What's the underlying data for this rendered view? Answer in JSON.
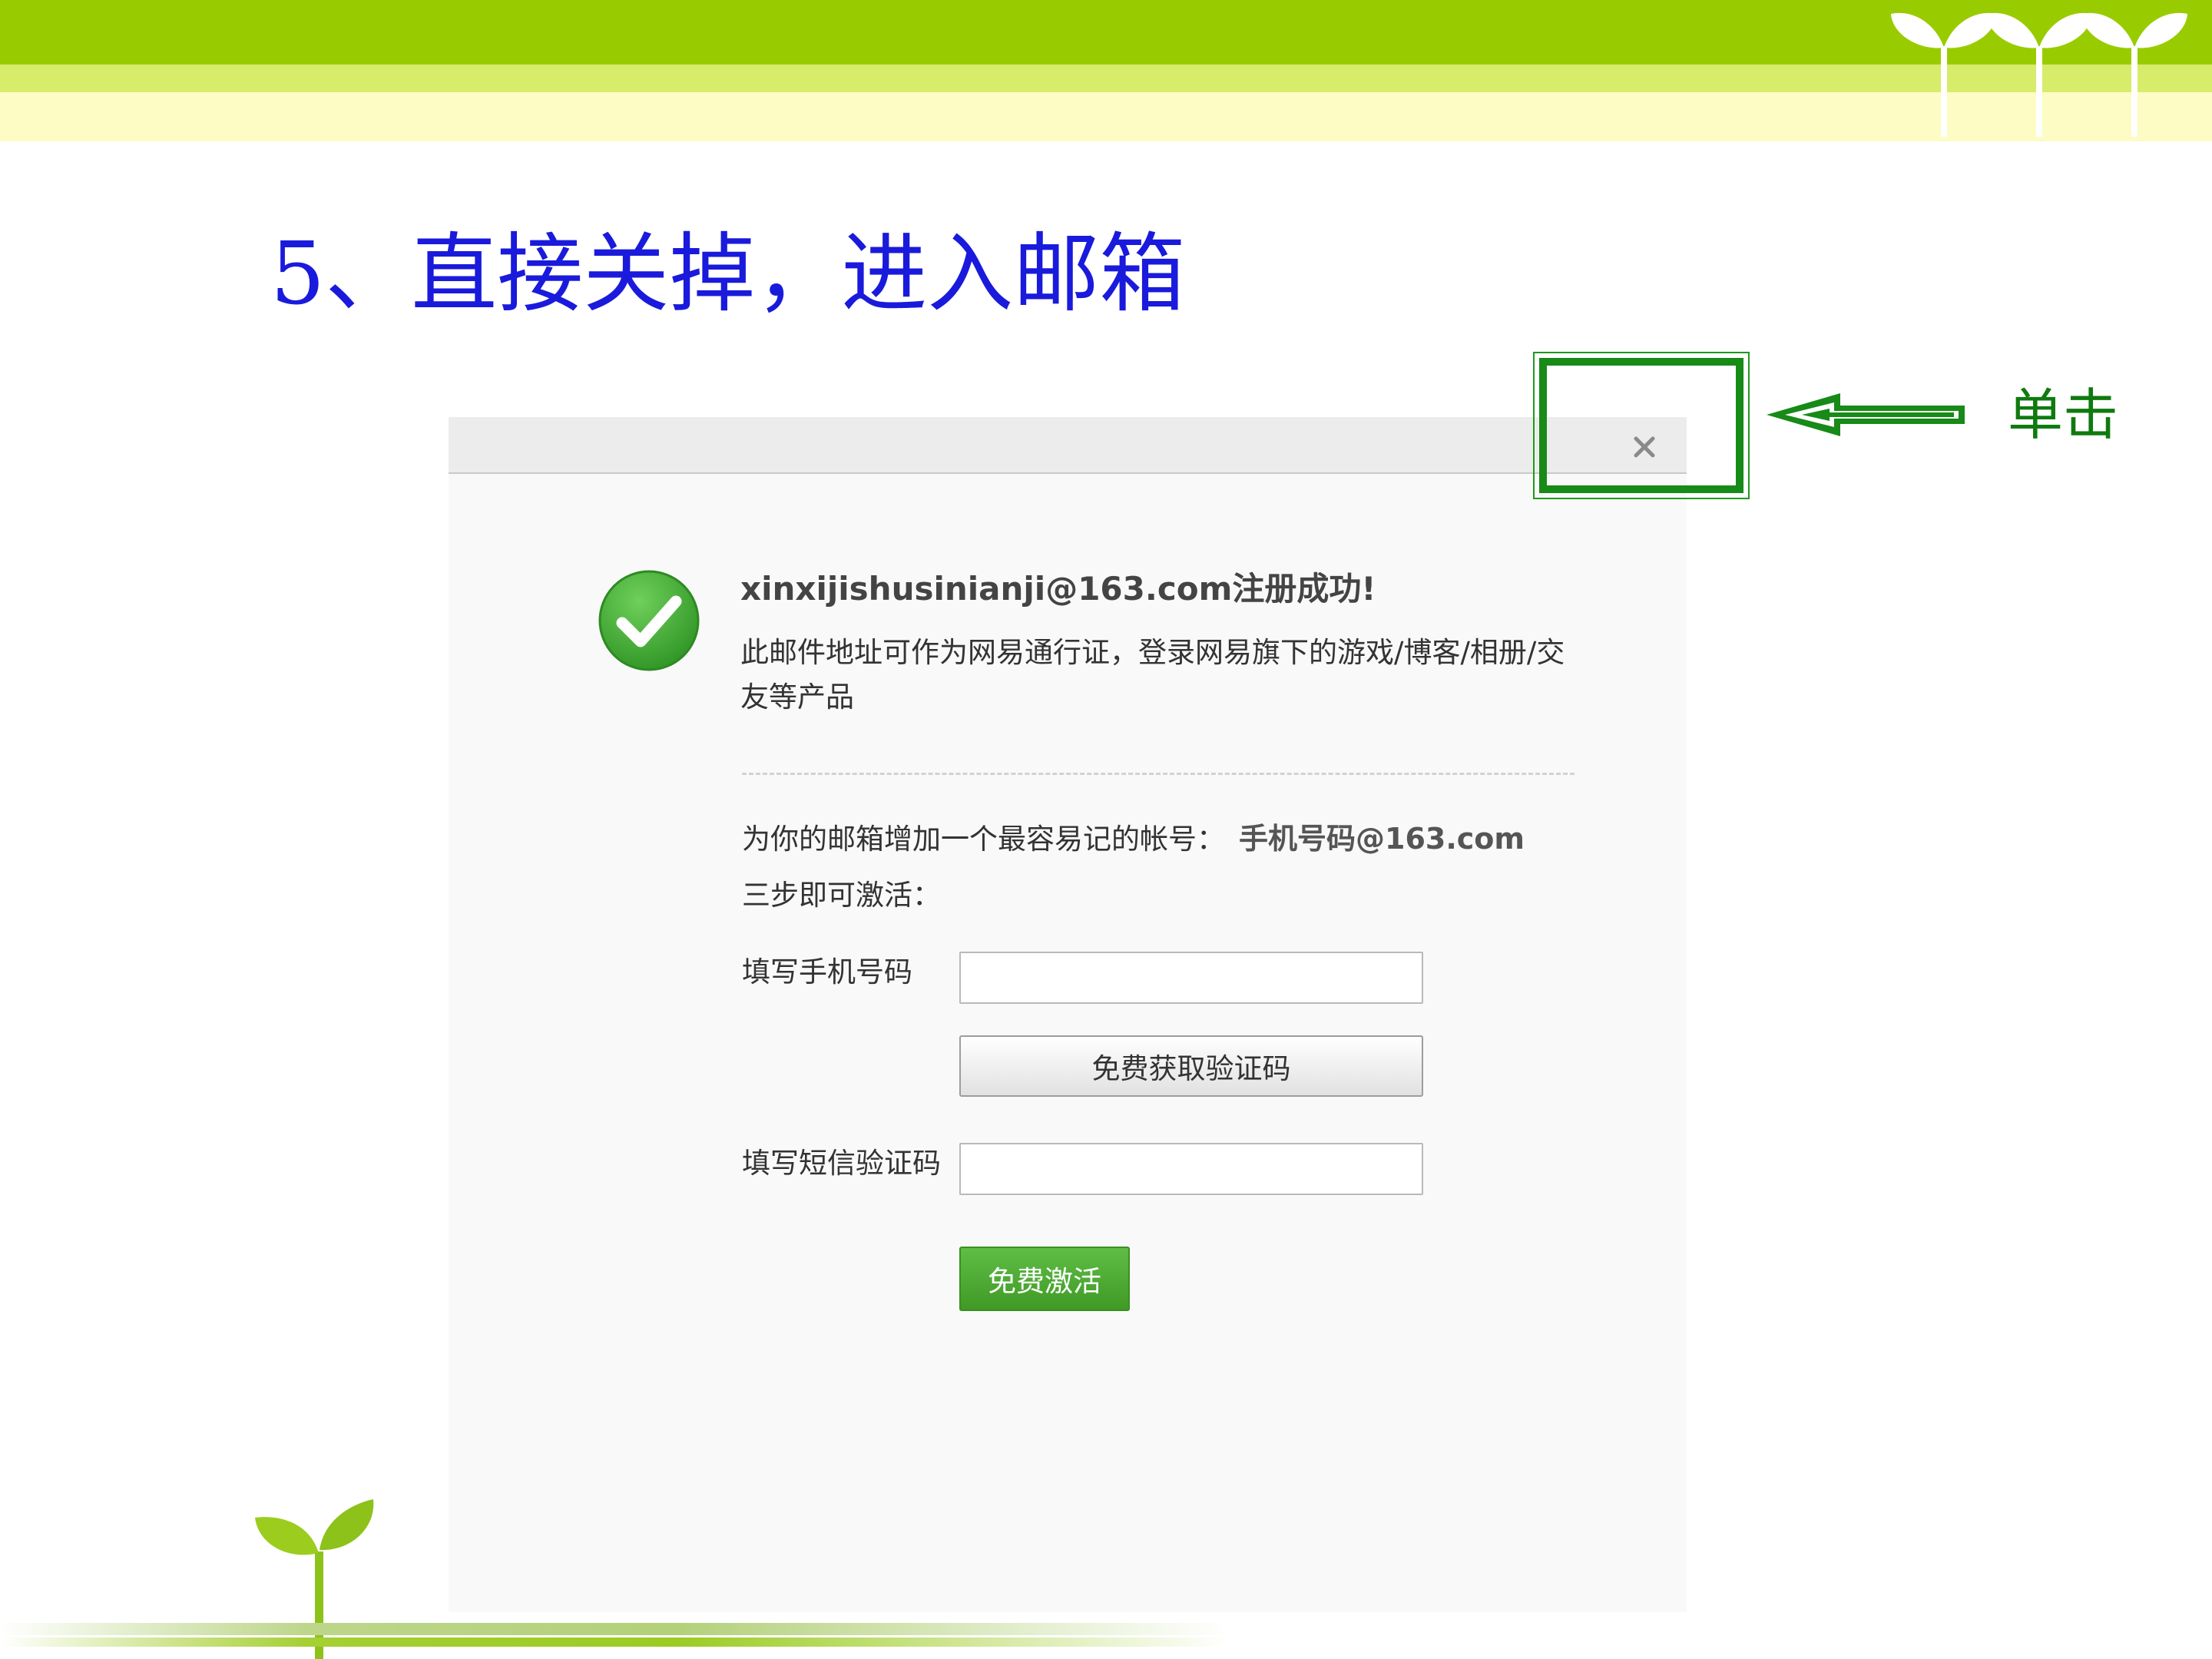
{
  "slide": {
    "title": "5、直接关掉，进入邮箱",
    "annotation": "单击",
    "colors": {
      "band_green": "#99cc00",
      "band_light": "#d6ec6a",
      "band_cream": "#fcfcc4",
      "title_blue": "#1a1adc",
      "highlight_green": "#178a17"
    }
  },
  "dialog": {
    "close_icon": "close-icon",
    "success_icon": "check-circle-icon",
    "success_title": "xinxijishusinianji@163.com注册成功!",
    "success_desc": "此邮件地址可作为网易通行证，登录网易旗下的游戏/博客/相册/交友等产品",
    "promo_text": "为你的邮箱增加一个最容易记的帐号：",
    "promo_account": "手机号码@163.com",
    "steps_text": "三步即可激活：",
    "phone_label": "填写手机号码",
    "phone_value": "",
    "get_code_button": "免费获取验证码",
    "sms_label": "填写短信验证码",
    "sms_value": "",
    "activate_button": "免费激活",
    "colors": {
      "activate_green": "#4cad33",
      "success_green": "#3ea332"
    }
  }
}
